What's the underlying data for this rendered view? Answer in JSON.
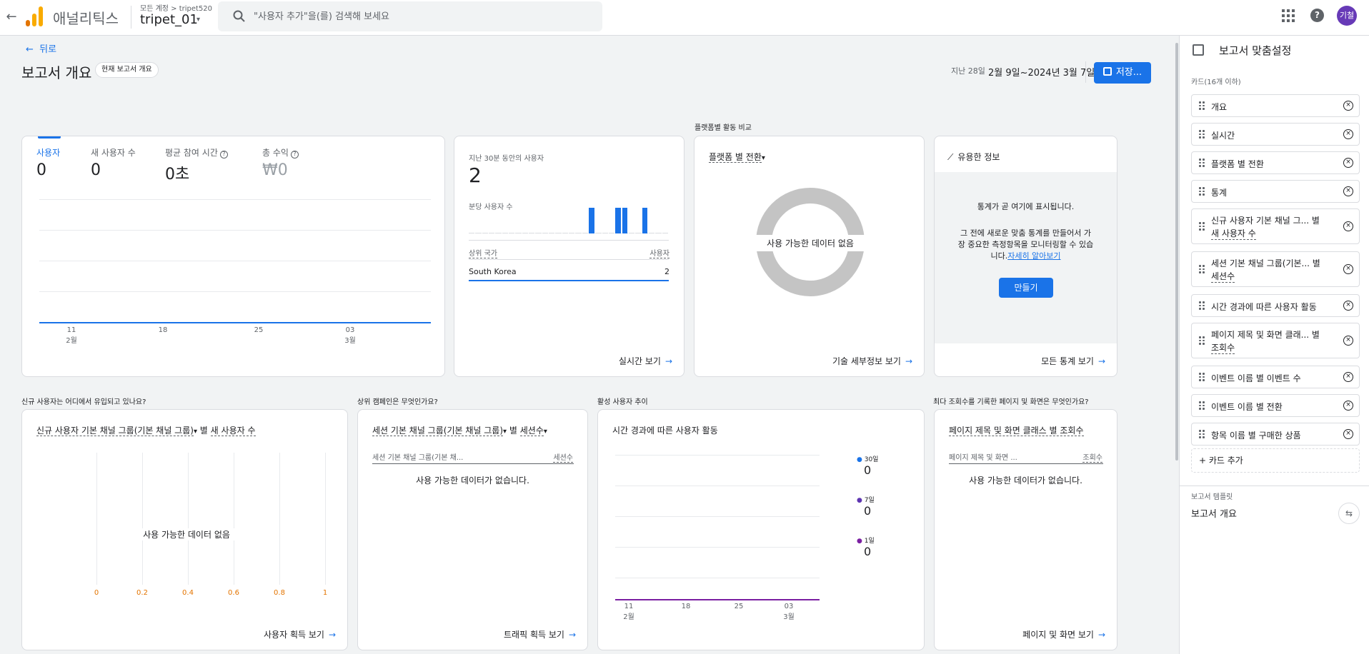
{
  "topbar": {
    "app_name": "애널리틱스",
    "account_crumb": "모든 계정 > tripet520",
    "property_name": "tripet_01",
    "search_placeholder": "\"사용자 추가\"을(를) 검색해 보세요",
    "avatar_text": "기철",
    "help_text": "?",
    "back_glyph": "←",
    "caret_glyph": "▾"
  },
  "header": {
    "back_label": "뒤로",
    "title": "보고서 개요",
    "badge": "현재 보고서 개요",
    "date_chip": "지난 28일",
    "date_range": "2월 9일~2024년 3월 7일",
    "save_label": "저장..."
  },
  "section_labels": {
    "platform_compare": "플랫폼별 활동 비교",
    "new_users_source": "신규 사용자는 어디에서 유입되고 있나요?",
    "top_campaigns": "상위 캠페인은 무엇인가요?",
    "active_users_trend": "활성 사용자 추이",
    "top_pages": "최다 조회수를 기록한 페이지 및 화면은 무엇인가요?"
  },
  "overview_card": {
    "metrics": [
      {
        "label": "사용자",
        "value": "0"
      },
      {
        "label": "새 사용자 수",
        "value": "0"
      },
      {
        "label": "평균 참여 시간",
        "value": "0초"
      },
      {
        "label": "총 수익",
        "value": "₩0"
      }
    ],
    "x_ticks": [
      {
        "day": "11",
        "month": "2월"
      },
      {
        "day": "18",
        "month": ""
      },
      {
        "day": "25",
        "month": ""
      },
      {
        "day": "03",
        "month": "3월"
      }
    ]
  },
  "realtime_card": {
    "label": "지난 30분 동안의 사용자",
    "value": "2",
    "per_minute_label": "분당 사용자 수",
    "col_country": "상위 국가",
    "col_users": "사용자",
    "rows": [
      {
        "country": "South Korea",
        "users": "2"
      }
    ],
    "footer": "실시간 보기",
    "bar_series": [
      0,
      0,
      0,
      0,
      0,
      0,
      0,
      0,
      0,
      0,
      0,
      0,
      0,
      0,
      0,
      0,
      0,
      0,
      1,
      0,
      0,
      0,
      1,
      1,
      0,
      0,
      1,
      0,
      0,
      0
    ]
  },
  "platform_card": {
    "title": "플랫폼 별 전환",
    "empty": "사용 가능한 데이터 없음",
    "footer": "기술 세부정보 보기"
  },
  "insights_card": {
    "title": "유용한 정보",
    "line1": "통계가 곧 여기에 표시됩니다.",
    "line2": "그 전에 새로운 맞춤 통계를 만들어서 가",
    "line3": "장 중요한 측정항목을 모니터링할 수 있습",
    "line4": "니다.",
    "learn_more": "자세히 알아보기",
    "create_label": "만들기",
    "footer": "모든 통계 보기"
  },
  "acquisition_card": {
    "title_a": "신규 사용자 기본 채널 그룹(기본 채널 그룹)",
    "title_b": "별",
    "title_c": "새 사용자 수",
    "empty": "사용 가능한 데이터 없음",
    "x_ticks": [
      "0",
      "0.2",
      "0.4",
      "0.6",
      "0.8",
      "1"
    ],
    "footer": "사용자 획득 보기"
  },
  "traffic_card": {
    "title_a": "세션 기본 채널 그룹(기본 채널 그룹)",
    "title_b": "별",
    "title_c": "세션수",
    "col_left": "세션 기본 채널 그룹(기본 채...",
    "col_right": "세션수",
    "empty": "사용 가능한 데이터가 없습니다.",
    "footer": "트래픽 획득 보기"
  },
  "activity_card": {
    "title": "시간 경과에 따른 사용자 활동",
    "legend": [
      {
        "label": "30일",
        "value": "0",
        "color": "#1a73e8"
      },
      {
        "label": "7일",
        "value": "0",
        "color": "#5e35b1"
      },
      {
        "label": "1일",
        "value": "0",
        "color": "#7b1fa2"
      }
    ],
    "x_ticks": [
      {
        "day": "11",
        "month": "2월"
      },
      {
        "day": "18",
        "month": ""
      },
      {
        "day": "25",
        "month": ""
      },
      {
        "day": "03",
        "month": "3월"
      }
    ]
  },
  "pages_card": {
    "title": "페이지 제목 및 화면 클래스 별 조회수",
    "col_left": "페이지 제목 및 화면 ...",
    "col_right": "조회수",
    "empty": "사용 가능한 데이터가 없습니다.",
    "footer": "페이지 및 화면 보기"
  },
  "right_panel": {
    "title": "보고서 맞춤설정",
    "cards_label": "카드(16개 이하)",
    "items": [
      {
        "line1": "개요",
        "line2": ""
      },
      {
        "line1": "실시간",
        "line2": ""
      },
      {
        "line1": "플랫폼 별 전환",
        "line2": ""
      },
      {
        "line1": "통계",
        "line2": ""
      },
      {
        "line1": "신규 사용자 기본 채널 그... 별",
        "line2": "새 사용자 수"
      },
      {
        "line1": "세션 기본 채널 그룹(기본... 별",
        "line2": "세션수"
      },
      {
        "line1": "시간 경과에 따른 사용자 활동",
        "line2": ""
      },
      {
        "line1": "페이지 제목 및 화면 클래... 별",
        "line2": "조회수"
      },
      {
        "line1": "이벤트 이름 별 이벤트 수",
        "line2": ""
      },
      {
        "line1": "이벤트 이름 별 전환",
        "line2": ""
      },
      {
        "line1": "항목 이름 별 구매한 상품",
        "line2": ""
      }
    ],
    "add_card": "+ 카드 추가",
    "template_label": "보고서 템플릿",
    "template_name": "보고서 개요"
  },
  "colors": {
    "accent": "#1a73e8",
    "ga_orange": "#f9ab00",
    "ga_orange_dark": "#e37400"
  }
}
